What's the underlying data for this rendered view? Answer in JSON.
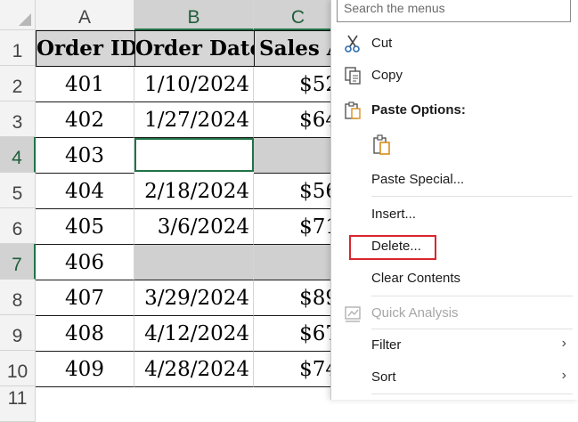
{
  "columns": [
    "A",
    "B",
    "C"
  ],
  "rows": [
    "1",
    "2",
    "3",
    "4",
    "5",
    "6",
    "7",
    "8",
    "9",
    "10",
    "11"
  ],
  "headers": [
    "Order ID",
    "Order Date",
    "Sales A"
  ],
  "data": [
    {
      "id": "401",
      "date": "1/10/2024",
      "sales": "$52"
    },
    {
      "id": "402",
      "date": "1/27/2024",
      "sales": "$64"
    },
    {
      "id": "403",
      "date": "",
      "sales": ""
    },
    {
      "id": "404",
      "date": "2/18/2024",
      "sales": "$56"
    },
    {
      "id": "405",
      "date": "3/6/2024",
      "sales": "$71"
    },
    {
      "id": "406",
      "date": "",
      "sales": ""
    },
    {
      "id": "407",
      "date": "3/29/2024",
      "sales": "$89"
    },
    {
      "id": "408",
      "date": "4/12/2024",
      "sales": "$67"
    },
    {
      "id": "409",
      "date": "4/28/2024",
      "sales": "$74"
    }
  ],
  "menu": {
    "search_placeholder": "Search the menus",
    "cut_pre": "",
    "cut_ul": "t",
    "cut_label": "Cut",
    "copy_label": "Copy",
    "paste_options": "Paste Options:",
    "paste_special": "Paste Special...",
    "insert": "Insert...",
    "delete": "Delete...",
    "clear_contents": "Clear Contents",
    "quick_analysis": "Quick Analysis",
    "filter": "Filter",
    "sort": "Sort",
    "chevron": "›"
  },
  "colors": {
    "accent": "#217346",
    "highlight": "#d9262e",
    "paste_icon": "#d98e1c"
  }
}
